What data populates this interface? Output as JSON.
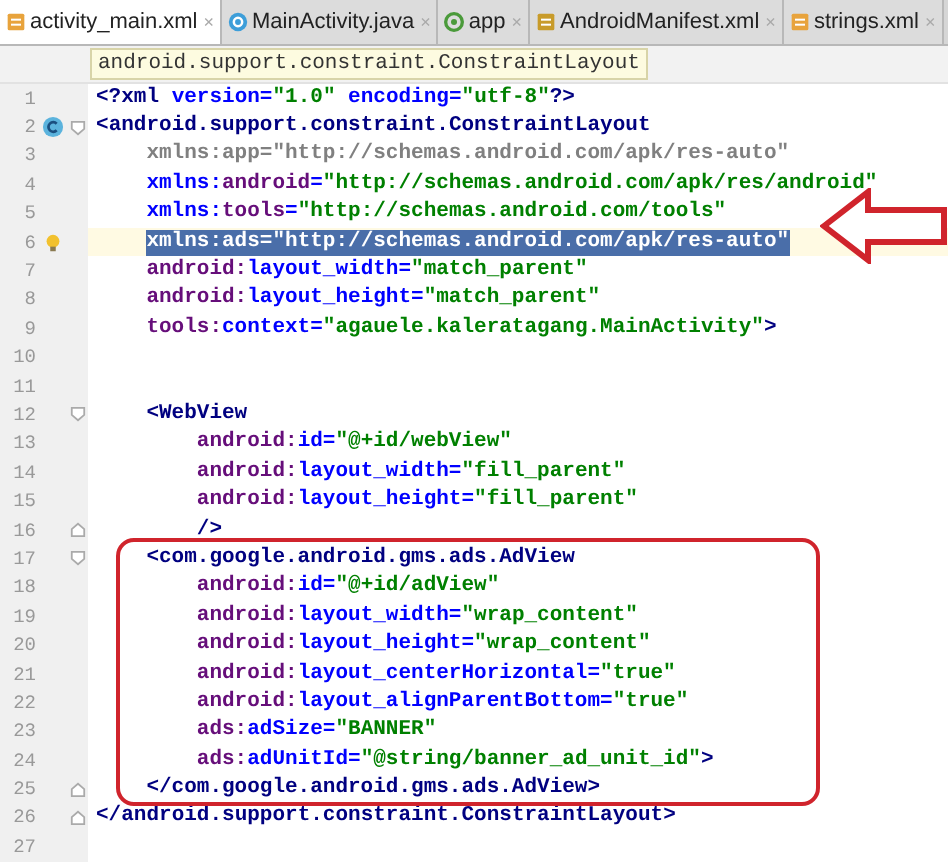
{
  "tabs": [
    {
      "label": "activity_main.xml",
      "kind": "xml",
      "selected": true
    },
    {
      "label": "MainActivity.java",
      "kind": "class",
      "selected": false
    },
    {
      "label": "app",
      "kind": "module",
      "selected": false
    },
    {
      "label": "AndroidManifest.xml",
      "kind": "manifest",
      "selected": false
    },
    {
      "label": "strings.xml",
      "kind": "xml",
      "selected": false
    }
  ],
  "close_glyph": "×",
  "breadcrumb": "android.support.constraint.ConstraintLayout",
  "lines": [
    {
      "number": "1",
      "selected": false,
      "current": false,
      "tokens": [
        {
          "kind": "punct",
          "text": "<?"
        },
        {
          "kind": "tag",
          "text": "xml"
        },
        {
          "kind": "attr",
          "text": " version="
        },
        {
          "kind": "value",
          "text": "\"1.0\""
        },
        {
          "kind": "attr",
          "text": " encoding="
        },
        {
          "kind": "value",
          "text": "\"utf-8\""
        },
        {
          "kind": "punct",
          "text": "?>"
        }
      ]
    },
    {
      "number": "2",
      "gutter_icon": {
        "kind": "class"
      },
      "fold_marker": {
        "kind": "start"
      },
      "selected": false,
      "current": false,
      "tokens": [
        {
          "kind": "punct",
          "text": "<"
        },
        {
          "kind": "tag",
          "text": "android.support.constraint.ConstraintLayout"
        }
      ],
      "children": [
        {
          "number": "3",
          "selected": false,
          "current": false,
          "tokens": [
            {
              "kind": "unused",
              "text": "xmlns:app=\"http://schemas.android.com/apk/res-auto\""
            }
          ]
        },
        {
          "number": "4",
          "selected": false,
          "current": false,
          "tokens": [
            {
              "kind": "attr",
              "text": "xmlns:"
            },
            {
              "kind": "prefix",
              "text": "android"
            },
            {
              "kind": "attr",
              "text": "="
            },
            {
              "kind": "value",
              "text": "\"http://schemas.android.com/apk/res/android\""
            }
          ]
        },
        {
          "number": "5",
          "selected": false,
          "current": false,
          "tokens": [
            {
              "kind": "attr",
              "text": "xmlns:"
            },
            {
              "kind": "prefix",
              "text": "tools"
            },
            {
              "kind": "attr",
              "text": "="
            },
            {
              "kind": "value",
              "text": "\"http://schemas.android.com/tools\""
            }
          ]
        },
        {
          "number": "6",
          "gutter_icon": {
            "kind": "bulb"
          },
          "selected": true,
          "current": true,
          "tokens": [
            {
              "kind": "attr",
              "text": "xmlns:"
            },
            {
              "kind": "prefix",
              "text": "ads"
            },
            {
              "kind": "attr",
              "text": "="
            },
            {
              "kind": "value",
              "text": "\"http://schemas.android.com/apk/res-auto\""
            }
          ]
        },
        {
          "number": "7",
          "selected": false,
          "current": false,
          "tokens": [
            {
              "kind": "prefix",
              "text": "android:"
            },
            {
              "kind": "attr",
              "text": "layout_width="
            },
            {
              "kind": "value",
              "text": "\"match_parent\""
            }
          ]
        },
        {
          "number": "8",
          "selected": false,
          "current": false,
          "tokens": [
            {
              "kind": "prefix",
              "text": "android:"
            },
            {
              "kind": "attr",
              "text": "layout_height="
            },
            {
              "kind": "value",
              "text": "\"match_parent\""
            }
          ]
        },
        {
          "number": "9",
          "selected": false,
          "current": false,
          "tokens": [
            {
              "kind": "prefix",
              "text": "tools:"
            },
            {
              "kind": "attr",
              "text": "context="
            },
            {
              "kind": "value",
              "text": "\"agauele.kaleratagang.MainActivity\""
            },
            {
              "kind": "punct",
              "text": ">"
            }
          ]
        },
        {
          "number": "10",
          "selected": false,
          "current": false
        },
        {
          "number": "11",
          "selected": false,
          "current": false
        },
        {
          "number": "12",
          "fold_marker": {
            "kind": "start"
          },
          "selected": false,
          "current": false,
          "tokens": [
            {
              "kind": "punct",
              "text": "<"
            },
            {
              "kind": "tag",
              "text": "WebView"
            }
          ],
          "children": [
            {
              "number": "13",
              "selected": false,
              "current": false,
              "tokens": [
                {
                  "kind": "prefix",
                  "text": "android:"
                },
                {
                  "kind": "attr",
                  "text": "id="
                },
                {
                  "kind": "value",
                  "text": "\"@+id/webView\""
                }
              ]
            },
            {
              "number": "14",
              "selected": false,
              "current": false,
              "tokens": [
                {
                  "kind": "prefix",
                  "text": "android:"
                },
                {
                  "kind": "attr",
                  "text": "layout_width="
                },
                {
                  "kind": "value",
                  "text": "\"fill_parent\""
                }
              ]
            },
            {
              "number": "15",
              "selected": false,
              "current": false,
              "tokens": [
                {
                  "kind": "prefix",
                  "text": "android:"
                },
                {
                  "kind": "attr",
                  "text": "layout_height="
                },
                {
                  "kind": "value",
                  "text": "\"fill_parent\""
                }
              ]
            },
            {
              "number": "16",
              "fold_marker": {
                "kind": "end"
              },
              "selected": false,
              "current": false,
              "tokens": [
                {
                  "kind": "punct",
                  "text": "/>"
                }
              ]
            }
          ]
        },
        {
          "number": "17",
          "fold_marker": {
            "kind": "start"
          },
          "selected": false,
          "current": false,
          "tokens": [
            {
              "kind": "punct",
              "text": "<"
            },
            {
              "kind": "tag",
              "text": "com.google.android.gms.ads.AdView"
            }
          ],
          "children": [
            {
              "number": "18",
              "selected": false,
              "current": false,
              "tokens": [
                {
                  "kind": "prefix",
                  "text": "android:"
                },
                {
                  "kind": "attr",
                  "text": "id="
                },
                {
                  "kind": "value",
                  "text": "\"@+id/adView\""
                }
              ]
            },
            {
              "number": "19",
              "selected": false,
              "current": false,
              "tokens": [
                {
                  "kind": "prefix",
                  "text": "android:"
                },
                {
                  "kind": "attr",
                  "text": "layout_width="
                },
                {
                  "kind": "value",
                  "text": "\"wrap_content\""
                }
              ]
            },
            {
              "number": "20",
              "selected": false,
              "current": false,
              "tokens": [
                {
                  "kind": "prefix",
                  "text": "android:"
                },
                {
                  "kind": "attr",
                  "text": "layout_height="
                },
                {
                  "kind": "value",
                  "text": "\"wrap_content\""
                }
              ]
            },
            {
              "number": "21",
              "selected": false,
              "current": false,
              "tokens": [
                {
                  "kind": "prefix",
                  "text": "android:"
                },
                {
                  "kind": "attr",
                  "text": "layout_centerHorizontal="
                },
                {
                  "kind": "value",
                  "text": "\"true\""
                }
              ]
            },
            {
              "number": "22",
              "selected": false,
              "current": false,
              "tokens": [
                {
                  "kind": "prefix",
                  "text": "android:"
                },
                {
                  "kind": "attr",
                  "text": "layout_alignParentBottom="
                },
                {
                  "kind": "value",
                  "text": "\"true\""
                }
              ]
            },
            {
              "number": "23",
              "selected": false,
              "current": false,
              "tokens": [
                {
                  "kind": "prefix",
                  "text": "ads:"
                },
                {
                  "kind": "attr",
                  "text": "adSize="
                },
                {
                  "kind": "value",
                  "text": "\"BANNER\""
                }
              ]
            },
            {
              "number": "24",
              "selected": false,
              "current": false,
              "tokens": [
                {
                  "kind": "prefix",
                  "text": "ads:"
                },
                {
                  "kind": "attr",
                  "text": "adUnitId="
                },
                {
                  "kind": "value",
                  "text": "\"@string/banner_ad_unit_id\""
                },
                {
                  "kind": "punct",
                  "text": ">"
                }
              ]
            }
          ]
        },
        {
          "number": "25",
          "fold_marker": {
            "kind": "end"
          },
          "selected": false,
          "current": false,
          "tokens": [
            {
              "kind": "punct",
              "text": "</"
            },
            {
              "kind": "tag",
              "text": "com.google.android.gms.ads.AdView"
            },
            {
              "kind": "punct",
              "text": ">"
            }
          ]
        }
      ]
    },
    {
      "number": "26",
      "fold_marker": {
        "kind": "end"
      },
      "selected": false,
      "current": false,
      "tokens": [
        {
          "kind": "punct",
          "text": "</"
        },
        {
          "kind": "tag",
          "text": "android.support.constraint.ConstraintLayout"
        },
        {
          "kind": "punct",
          "text": ">"
        }
      ]
    },
    {
      "number": "27",
      "selected": false,
      "current": false
    }
  ]
}
